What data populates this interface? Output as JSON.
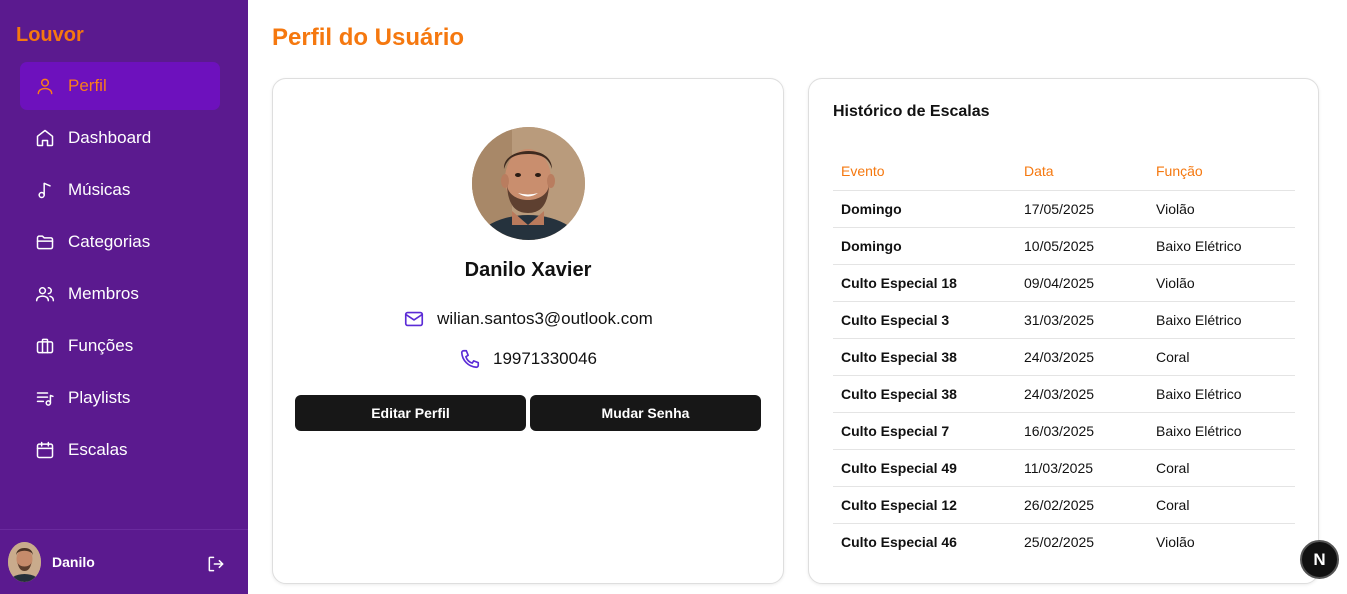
{
  "sidebar": {
    "brand": "Louvor",
    "items": [
      {
        "label": "Perfil",
        "icon": "user-icon",
        "active": true
      },
      {
        "label": "Dashboard",
        "icon": "home-icon"
      },
      {
        "label": "Músicas",
        "icon": "music-note-icon"
      },
      {
        "label": "Categorias",
        "icon": "folder-icon"
      },
      {
        "label": "Membros",
        "icon": "users-icon"
      },
      {
        "label": "Funções",
        "icon": "briefcase-icon"
      },
      {
        "label": "Playlists",
        "icon": "playlist-icon"
      },
      {
        "label": "Escalas",
        "icon": "calendar-icon"
      }
    ],
    "footer": {
      "user_name": "Danilo",
      "logout_icon": "logout-icon"
    }
  },
  "main": {
    "title": "Perfil do Usuário"
  },
  "profile": {
    "name": "Danilo Xavier",
    "email": "wilian.santos3@outlook.com",
    "phone": "19971330046",
    "edit_label": "Editar Perfil",
    "password_label": "Mudar Senha"
  },
  "history": {
    "title": "Histórico de Escalas",
    "columns": [
      "Evento",
      "Data",
      "Função"
    ],
    "rows": [
      [
        "Domingo",
        "17/05/2025",
        "Violão"
      ],
      [
        "Domingo",
        "10/05/2025",
        "Baixo Elétrico"
      ],
      [
        "Culto Especial 18",
        "09/04/2025",
        "Violão"
      ],
      [
        "Culto Especial 3",
        "31/03/2025",
        "Baixo Elétrico"
      ],
      [
        "Culto Especial 38",
        "24/03/2025",
        "Coral"
      ],
      [
        "Culto Especial 38",
        "24/03/2025",
        "Baixo Elétrico"
      ],
      [
        "Culto Especial 7",
        "16/03/2025",
        "Baixo Elétrico"
      ],
      [
        "Culto Especial 49",
        "11/03/2025",
        "Coral"
      ],
      [
        "Culto Especial 12",
        "26/02/2025",
        "Coral"
      ],
      [
        "Culto Especial 46",
        "25/02/2025",
        "Violão"
      ]
    ]
  },
  "badge": {
    "label": "N"
  },
  "colors": {
    "sidebar": "#5b1a8f",
    "active_item": "#6d11bd",
    "accent": "#f5780f",
    "contact_icon": "#5b2bd6",
    "button": "#171717"
  }
}
